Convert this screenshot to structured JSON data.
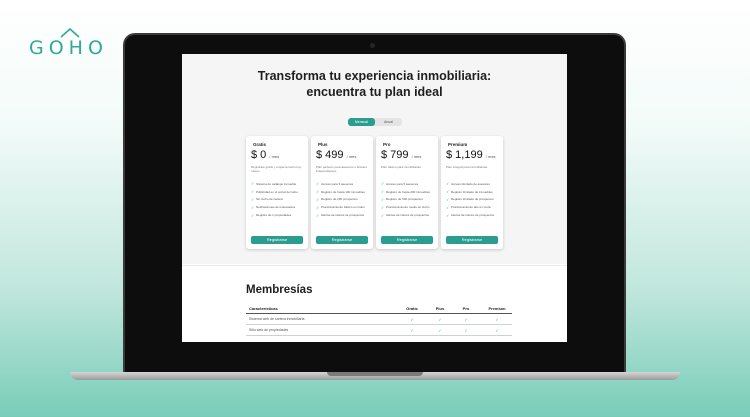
{
  "brand": {
    "logo_text": "GOHO",
    "registered_mark": "®",
    "color": "#2fa99a"
  },
  "hero": {
    "title_line1": "Transforma tu experiencia inmobiliaria:",
    "title_line2": "encuentra tu plan ideal"
  },
  "billing_toggle": {
    "options": [
      "Mensual",
      "Anual"
    ],
    "selected": "Mensual"
  },
  "plans": [
    {
      "name": "Gratis",
      "price": "$ 0",
      "period": "/ mes",
      "description": "Regístrate gratis y empieza Goho hoy mismo",
      "features": [
        "Sistema de catálogo inmueble",
        "Publicidad en el portal de Goho",
        "Sin Goho de cartera",
        "Notificaciones de interesados",
        "Registro de 1 propiedades"
      ],
      "button": "Registrarse"
    },
    {
      "name": "Plus",
      "price": "$ 499",
      "period": "/ mes",
      "description": "Plan perfecto para asesores o brokers independientes",
      "features": [
        "Acceso para 3 asesores",
        "Registro de hasta 100 inmuebles",
        "Registro de 200 prospectos",
        "Posicionamiento básico en Goho",
        "Alertas de interés de prospectos"
      ],
      "button": "Registrarse"
    },
    {
      "name": "Pro",
      "price": "$ 799",
      "period": "/ mes",
      "description": "Plan básico para inmobiliarias.",
      "features": [
        "Acceso para 5 asesores",
        "Registro de hasta 200 inmuebles",
        "Registro de 500 prospectos",
        "Posicionamiento medio en Goho",
        "Alertas de interés de prospectos"
      ],
      "button": "Registrarse"
    },
    {
      "name": "Premium",
      "price": "$ 1,199",
      "period": "/ mes",
      "description": "Plan integral para inmobiliarias.",
      "features": [
        "Acceso ilimitado de asesores",
        "Registro ilimitado de inmuebles",
        "Registro ilimitado de prospectos",
        "Posicionamiento alto en Goho",
        "Alertas de interés de prospectos"
      ],
      "button": "Registrarse"
    }
  ],
  "memberships": {
    "title": "Membresías",
    "headers": [
      "Características",
      "Gratis",
      "Plus",
      "Pro",
      "Premium"
    ],
    "rows": [
      {
        "feature": "Sistema web de cartera inmobiliaria",
        "marks": [
          "✓",
          "✓",
          "✓",
          "✓"
        ]
      },
      {
        "feature": "Sitio web de propiedades",
        "marks": [
          "✓",
          "✓",
          "✓",
          "✓"
        ]
      }
    ]
  },
  "colors": {
    "accent": "#2a9d8f",
    "background_gradient_bottom": "#79cdb8"
  }
}
